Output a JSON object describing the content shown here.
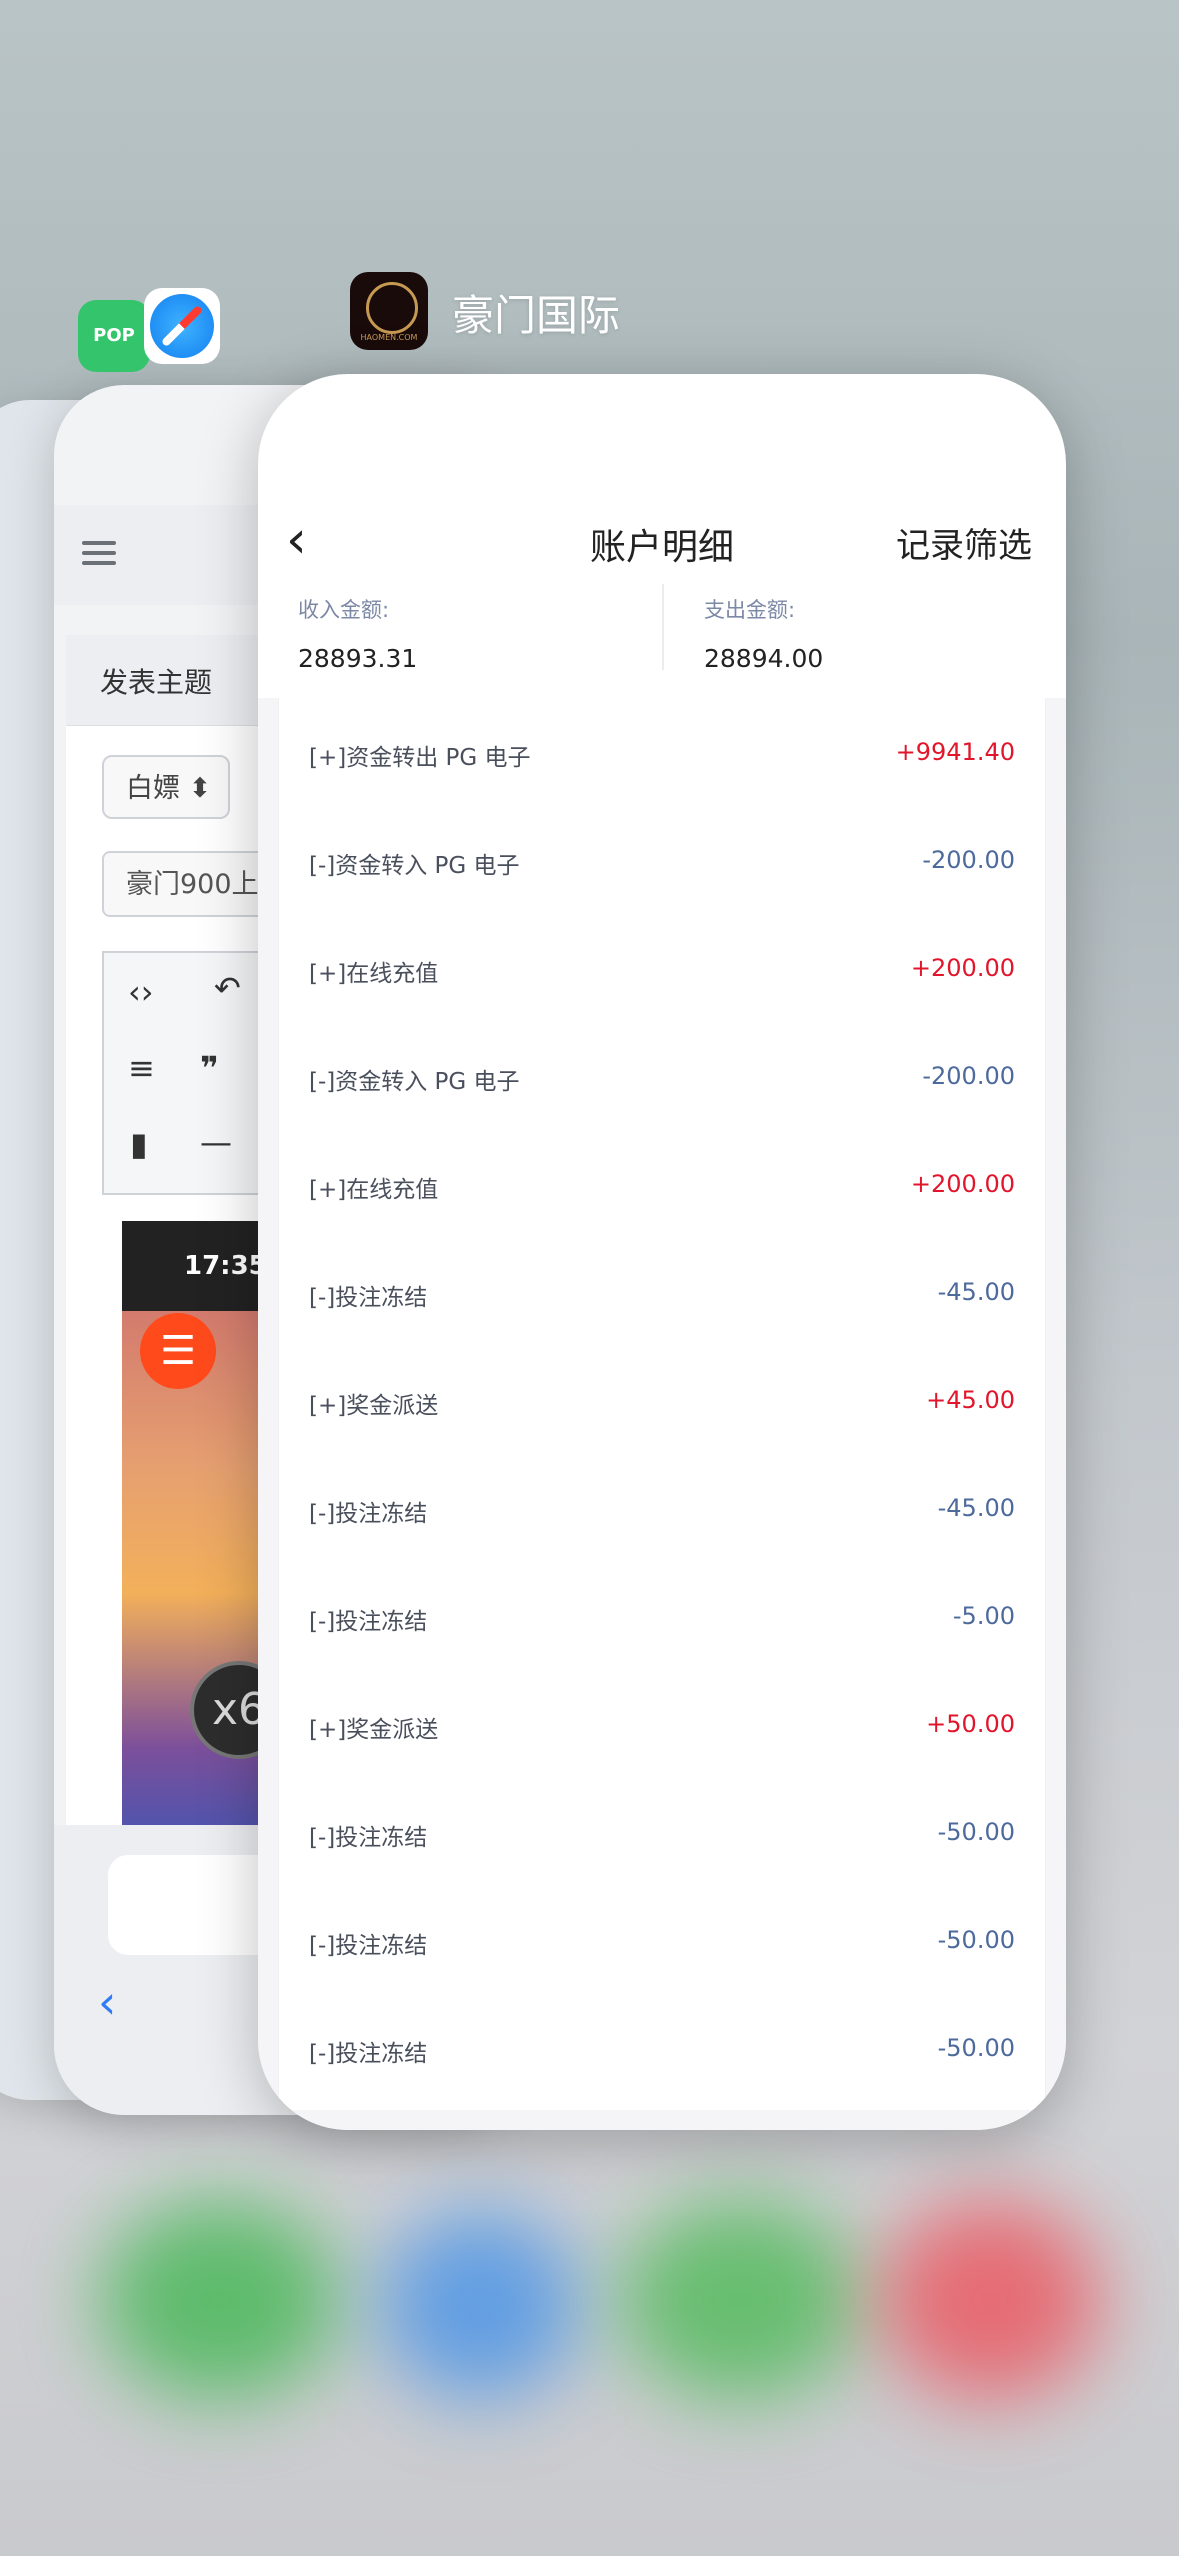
{
  "switcher": {
    "app_name": "豪门国际",
    "pop_icon_label": "POP",
    "hm_icon_text": "HAOMEN.COM"
  },
  "back_card": {
    "post_title": "发表主题",
    "select_value": "白嫖",
    "subject_value": "豪门900上",
    "game_time": "17:35",
    "game_coin_label": "x6"
  },
  "account": {
    "title": "账户明细",
    "filter_label": "记录筛选",
    "income_label": "收入金额:",
    "income_value": "28893.31",
    "expense_label": "支出金额:",
    "expense_value": "28894.00",
    "transactions": [
      {
        "label": "[+]资金转出 PG 电子",
        "amount": "+9941.40"
      },
      {
        "label": "[-]资金转入 PG 电子",
        "amount": "-200.00"
      },
      {
        "label": "[+]在线充值",
        "amount": "+200.00"
      },
      {
        "label": "[-]资金转入 PG 电子",
        "amount": "-200.00"
      },
      {
        "label": "[+]在线充值",
        "amount": "+200.00"
      },
      {
        "label": "[-]投注冻结",
        "amount": "-45.00"
      },
      {
        "label": "[+]奖金派送",
        "amount": "+45.00"
      },
      {
        "label": "[-]投注冻结",
        "amount": "-45.00"
      },
      {
        "label": "[-]投注冻结",
        "amount": "-5.00"
      },
      {
        "label": "[+]奖金派送",
        "amount": "+50.00"
      },
      {
        "label": "[-]投注冻结",
        "amount": "-50.00"
      },
      {
        "label": "[-]投注冻结",
        "amount": "-50.00"
      },
      {
        "label": "[-]投注冻结",
        "amount": "-50.00"
      }
    ]
  },
  "colors": {
    "positive": "#e1152b",
    "negative": "#4d6a9c"
  }
}
